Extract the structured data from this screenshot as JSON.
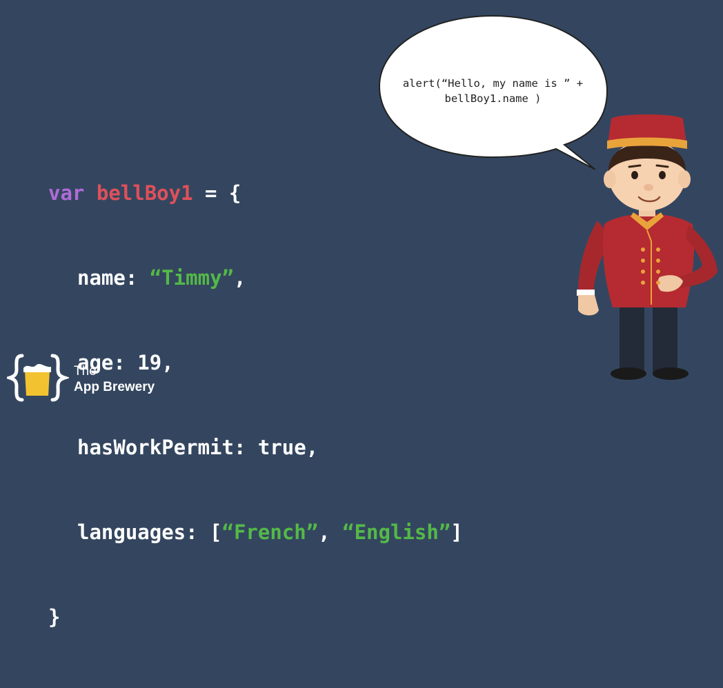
{
  "code": {
    "line1": {
      "keyword": "var",
      "identifier": "bellBoy1",
      "rest": " = {"
    },
    "line2": {
      "key": "name: ",
      "value": "“Timmy”",
      "suffix": ","
    },
    "line3": {
      "text": "age: 19,"
    },
    "line4": {
      "text": "hasWorkPermit: true,"
    },
    "line5": {
      "key": "languages: [",
      "value1": "“French”",
      "sep": ", ",
      "value2": "“English”",
      "suffix": "]"
    },
    "line6": {
      "text": "}"
    }
  },
  "speech_bubble": {
    "line1": "alert(“Hello, my name is ” +",
    "line2": "bellBoy1.name )"
  },
  "logo": {
    "line1": "The",
    "line2": "App Brewery",
    "icon": "brackets-beer-mug-icon"
  },
  "character": {
    "icon": "bellboy-illustration"
  },
  "colors": {
    "background": "#34465f",
    "keyword": "#b06bd8",
    "identifier": "#e0505a",
    "string": "#54b948",
    "text": "#ffffff"
  }
}
